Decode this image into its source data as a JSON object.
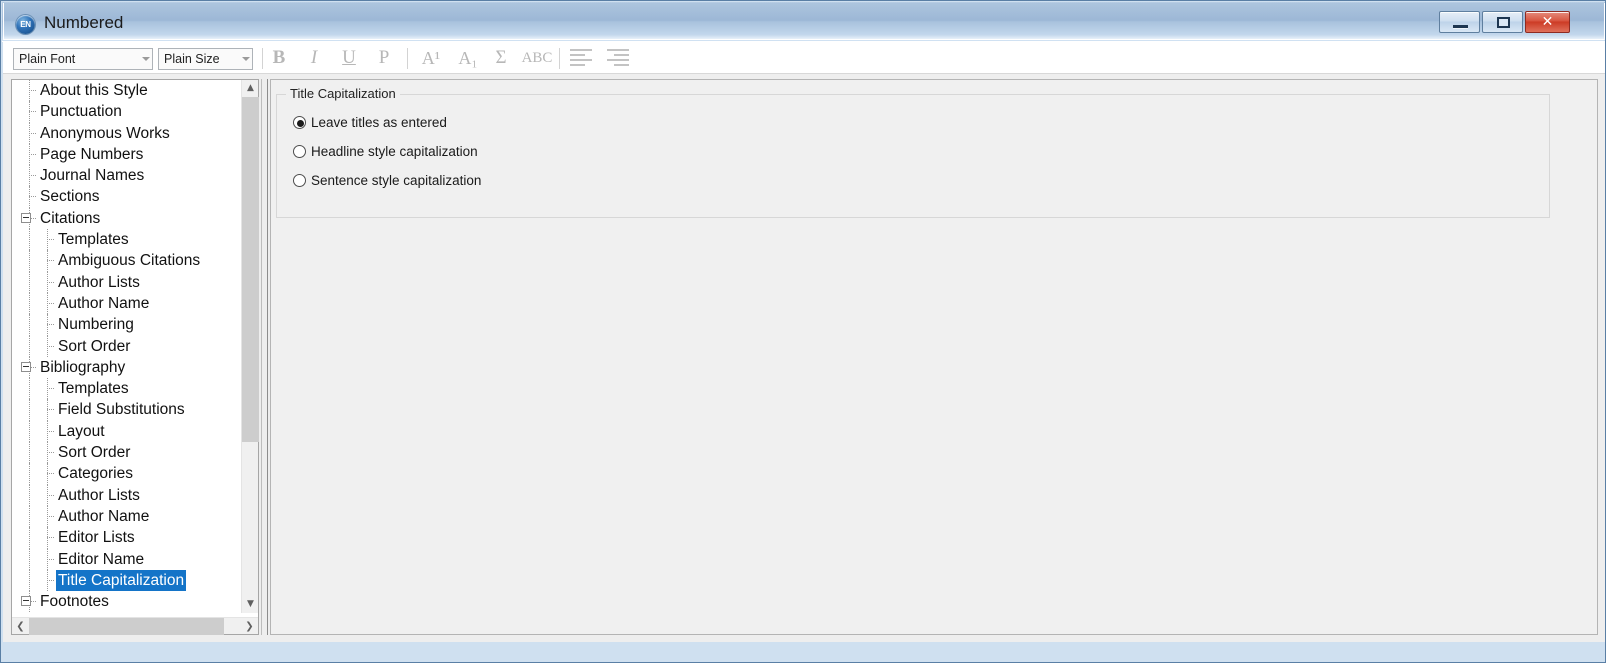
{
  "window": {
    "title": "Numbered",
    "icon": "endnote-icon",
    "icon_text": "EN",
    "controls": {
      "minimize": "Minimize",
      "maximize": "Restore",
      "close": "Close"
    }
  },
  "toolbar": {
    "font_combo": {
      "value": "Plain Font",
      "placeholder": "Plain Font"
    },
    "size_combo": {
      "value": "Plain Size",
      "placeholder": "Plain Size"
    },
    "buttons": [
      {
        "name": "bold-button",
        "glyph": "B"
      },
      {
        "name": "italic-button",
        "glyph": "I"
      },
      {
        "name": "underline-button",
        "glyph": "U"
      },
      {
        "name": "plain-button",
        "glyph": "P"
      },
      {
        "name": "superscript-button",
        "glyph": "A¹"
      },
      {
        "name": "subscript-button",
        "glyph": "A₁"
      },
      {
        "name": "symbol-button",
        "glyph": "Σ"
      },
      {
        "name": "spellcheck-button",
        "glyph": "ABC"
      }
    ],
    "align_left": "Align Left",
    "align_right": "Align Right"
  },
  "tree": {
    "items": [
      {
        "label": "About this Style",
        "level": 1,
        "expandable": false,
        "selected": false
      },
      {
        "label": "Punctuation",
        "level": 1,
        "expandable": false,
        "selected": false
      },
      {
        "label": "Anonymous Works",
        "level": 1,
        "expandable": false,
        "selected": false
      },
      {
        "label": "Page Numbers",
        "level": 1,
        "expandable": false,
        "selected": false
      },
      {
        "label": "Journal Names",
        "level": 1,
        "expandable": false,
        "selected": false
      },
      {
        "label": "Sections",
        "level": 1,
        "expandable": false,
        "selected": false
      },
      {
        "label": "Citations",
        "level": 1,
        "expandable": true,
        "selected": false
      },
      {
        "label": "Templates",
        "level": 2,
        "expandable": false,
        "selected": false
      },
      {
        "label": "Ambiguous Citations",
        "level": 2,
        "expandable": false,
        "selected": false
      },
      {
        "label": "Author Lists",
        "level": 2,
        "expandable": false,
        "selected": false
      },
      {
        "label": "Author Name",
        "level": 2,
        "expandable": false,
        "selected": false
      },
      {
        "label": "Numbering",
        "level": 2,
        "expandable": false,
        "selected": false
      },
      {
        "label": "Sort Order",
        "level": 2,
        "expandable": false,
        "selected": false
      },
      {
        "label": "Bibliography",
        "level": 1,
        "expandable": true,
        "selected": false
      },
      {
        "label": "Templates",
        "level": 2,
        "expandable": false,
        "selected": false
      },
      {
        "label": "Field Substitutions",
        "level": 2,
        "expandable": false,
        "selected": false
      },
      {
        "label": "Layout",
        "level": 2,
        "expandable": false,
        "selected": false
      },
      {
        "label": "Sort Order",
        "level": 2,
        "expandable": false,
        "selected": false
      },
      {
        "label": "Categories",
        "level": 2,
        "expandable": false,
        "selected": false
      },
      {
        "label": "Author Lists",
        "level": 2,
        "expandable": false,
        "selected": false
      },
      {
        "label": "Author Name",
        "level": 2,
        "expandable": false,
        "selected": false
      },
      {
        "label": "Editor Lists",
        "level": 2,
        "expandable": false,
        "selected": false
      },
      {
        "label": "Editor Name",
        "level": 2,
        "expandable": false,
        "selected": false
      },
      {
        "label": "Title Capitalization",
        "level": 2,
        "expandable": false,
        "selected": true
      },
      {
        "label": "Footnotes",
        "level": 1,
        "expandable": true,
        "selected": false
      }
    ],
    "selection_color": "#1474c8"
  },
  "content": {
    "group_title": "Title Capitalization",
    "radios": [
      {
        "label": "Leave titles as entered",
        "selected": true
      },
      {
        "label": "Headline style capitalization",
        "selected": false
      },
      {
        "label": "Sentence style capitalization",
        "selected": false
      }
    ]
  }
}
